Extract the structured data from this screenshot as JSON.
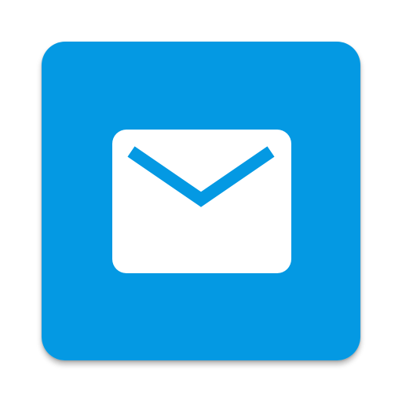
{
  "icon": {
    "name": "mail-icon",
    "background_color": "#0499E3",
    "glyph_color": "#FFFFFF"
  }
}
